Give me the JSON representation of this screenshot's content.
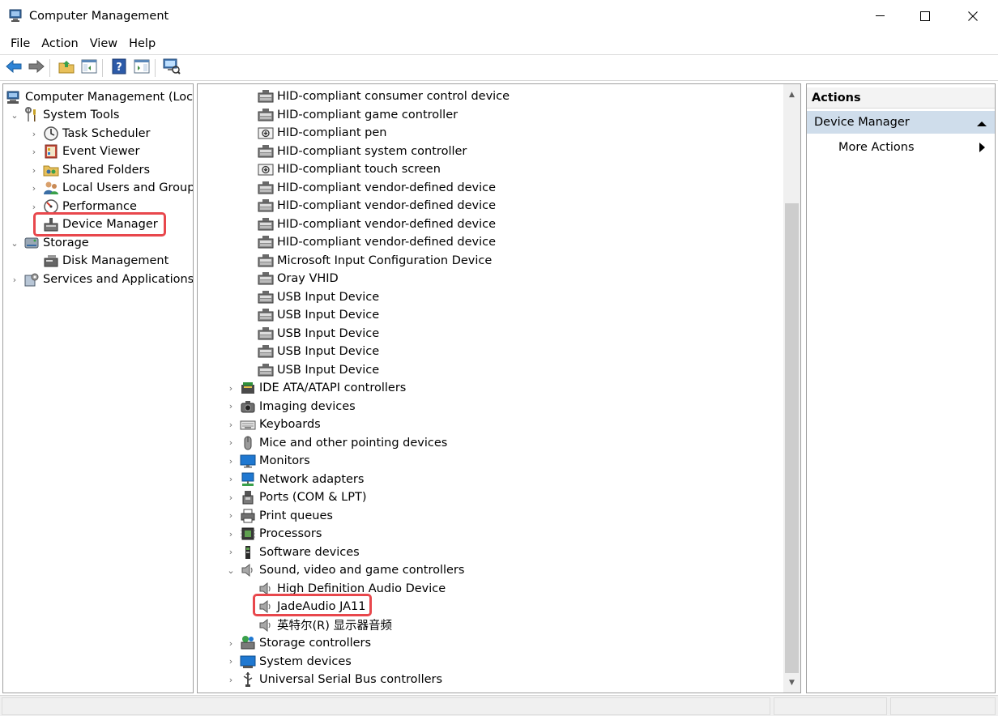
{
  "window": {
    "title": "Computer Management",
    "controls": [
      "minimize-icon",
      "maximize-icon",
      "close-icon"
    ]
  },
  "menu": [
    "File",
    "Action",
    "View",
    "Help"
  ],
  "toolbar": {
    "buttons": [
      "back-arrow-icon",
      "forward-arrow-icon",
      "up-folder-icon",
      "show-hide-console-tree-icon",
      "help-icon",
      "show-hide-action-pane-icon",
      "scan-hardware-icon"
    ]
  },
  "left_tree": {
    "root": "Computer Management (Local)",
    "system_tools": "System Tools",
    "task_scheduler": "Task Scheduler",
    "event_viewer": "Event Viewer",
    "shared_folders": "Shared Folders",
    "local_users": "Local Users and Groups",
    "performance": "Performance",
    "device_manager": "Device Manager",
    "storage": "Storage",
    "disk_management": "Disk Management",
    "services_apps": "Services and Applications"
  },
  "devices": {
    "hid_items": [
      "HID-compliant consumer control device",
      "HID-compliant game controller",
      "HID-compliant pen",
      "HID-compliant system controller",
      "HID-compliant touch screen",
      "HID-compliant vendor-defined device",
      "HID-compliant vendor-defined device",
      "HID-compliant vendor-defined device",
      "HID-compliant vendor-defined device",
      "Microsoft Input Configuration Device",
      "Oray VHID",
      "USB Input Device",
      "USB Input Device",
      "USB Input Device",
      "USB Input Device",
      "USB Input Device"
    ],
    "categories_a": [
      "IDE ATA/ATAPI controllers",
      "Imaging devices",
      "Keyboards",
      "Mice and other pointing devices",
      "Monitors",
      "Network adapters",
      "Ports (COM & LPT)",
      "Print queues",
      "Processors",
      "Software devices"
    ],
    "sound_category": "Sound, video and game controllers",
    "sound_items": [
      "High Definition Audio Device",
      "JadeAudio JA11",
      "英特尔(R) 显示器音频"
    ],
    "categories_b": [
      "Storage controllers",
      "System devices",
      "Universal Serial Bus controllers"
    ]
  },
  "actions": {
    "header": "Actions",
    "section": "Device Manager",
    "item": "More Actions"
  },
  "colors": {
    "highlight": "#e8474c",
    "actions_section_bg": "#cfddeb"
  }
}
